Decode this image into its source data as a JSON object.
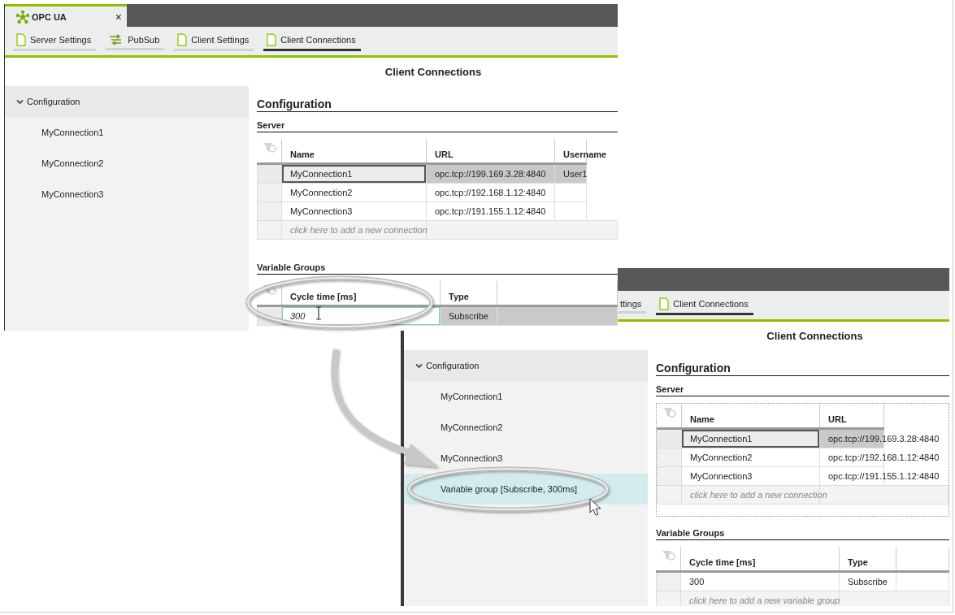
{
  "screens": [
    {
      "app_tab": {
        "title": "OPC UA",
        "close": "×"
      },
      "toolbar_tabs": [
        {
          "label": "Server Settings",
          "kind": "page",
          "selected": false
        },
        {
          "label": "PubSub",
          "kind": "pubsub",
          "selected": false
        },
        {
          "label": "Client Settings",
          "kind": "page",
          "selected": false
        },
        {
          "label": "Client Connections",
          "kind": "page",
          "selected": true
        }
      ],
      "page_title": "Client Connections",
      "tree": {
        "label": "Configuration",
        "expanded": true,
        "children": [
          {
            "label": "MyConnection1",
            "selected": false
          },
          {
            "label": "MyConnection2",
            "selected": false
          },
          {
            "label": "MyConnection3",
            "selected": false
          }
        ]
      },
      "section_title": "Configuration",
      "server": {
        "title": "Server",
        "columns": [
          "Name",
          "URL",
          "Username"
        ],
        "rows": [
          {
            "cells": [
              "MyConnection1",
              "opc.tcp://199.169.3.28:4840",
              "User1"
            ],
            "selected": true,
            "focused": true,
            "editing": false
          },
          {
            "cells": [
              "MyConnection2",
              "opc.tcp://192.168.1.12:4840",
              ""
            ],
            "selected": false,
            "focused": false,
            "editing": false
          },
          {
            "cells": [
              "MyConnection3",
              "opc.tcp://191.155.1.12:4840",
              ""
            ],
            "selected": false,
            "focused": false,
            "editing": false
          }
        ],
        "add_hint": "click here to add a new connection"
      },
      "variable_groups": {
        "title": "Variable Groups",
        "columns": [
          "Cycle time [ms]",
          "Type"
        ],
        "rows": [
          {
            "cells": [
              "300",
              "Subscribe"
            ],
            "selected": true,
            "focused": false,
            "editing": true
          }
        ]
      }
    },
    {
      "toolbar_tabs": [
        {
          "label": "ttings",
          "kind": "plain",
          "selected": false
        },
        {
          "label": "Client Connections",
          "kind": "page",
          "selected": true
        }
      ],
      "page_title": "Client Connections",
      "tree": {
        "label": "Configuration",
        "expanded": true,
        "children": [
          {
            "label": "MyConnection1",
            "selected": false
          },
          {
            "label": "MyConnection2",
            "selected": false
          },
          {
            "label": "MyConnection3",
            "selected": false
          },
          {
            "label": "Variable group [Subscribe, 300ms]",
            "selected": true
          }
        ]
      },
      "section_title": "Configuration",
      "server": {
        "title": "Server",
        "columns": [
          "Name",
          "URL"
        ],
        "rows": [
          {
            "cells": [
              "MyConnection1",
              "opc.tcp://199.169.3.28:4840"
            ],
            "selected": true,
            "focused": true,
            "editing": false
          },
          {
            "cells": [
              "MyConnection2",
              "opc.tcp://192.168.1.12:4840"
            ],
            "selected": false,
            "focused": false,
            "editing": false
          },
          {
            "cells": [
              "MyConnection3",
              "opc.tcp://191.155.1.12:4840"
            ],
            "selected": false,
            "focused": false,
            "editing": false
          }
        ],
        "add_hint": "click here to add a new connection"
      },
      "variable_groups": {
        "title": "Variable Groups",
        "columns": [
          "Cycle time [ms]",
          "Type"
        ],
        "rows": [
          {
            "cells": [
              "300",
              "Subscribe"
            ],
            "selected": false,
            "focused": false,
            "editing": false
          }
        ],
        "add_hint": "click here to add a new variable group"
      }
    }
  ]
}
